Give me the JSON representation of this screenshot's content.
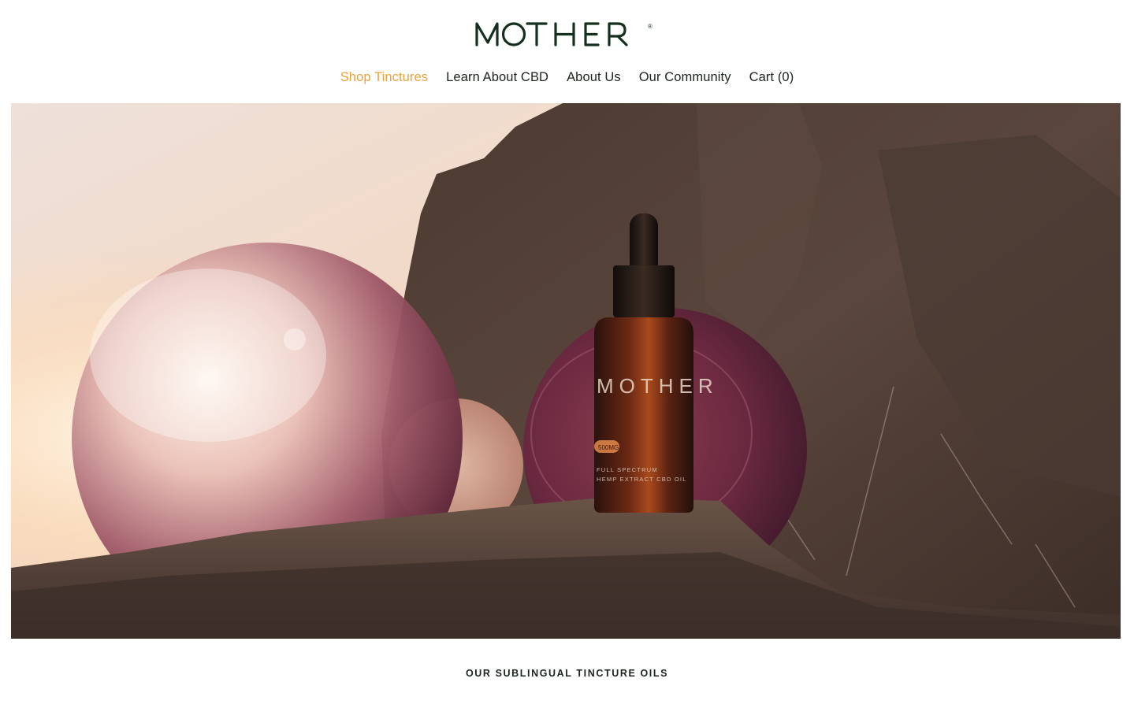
{
  "brand": {
    "name": "MOTHER",
    "registered_mark": "®",
    "logo_color": "#16301f"
  },
  "nav": {
    "items": [
      {
        "label": "Shop Tinctures",
        "active": true
      },
      {
        "label": "Learn About CBD",
        "active": false
      },
      {
        "label": "About Us",
        "active": false
      },
      {
        "label": "Our Community",
        "active": false
      },
      {
        "label": "Cart (0)",
        "active": false
      }
    ],
    "active_color": "#e9a23a"
  },
  "hero": {
    "image": "glass-spheres-and-cbd-tincture-bottle-on-rocks-at-sunset",
    "bottle_label": {
      "brand": "MOTHER",
      "strength": "500MG",
      "line1": "FULL SPECTRUM",
      "line2": "HEMP EXTRACT CBD OIL"
    }
  },
  "section": {
    "title": "OUR SUBLINGUAL TINCTURE OILS"
  }
}
